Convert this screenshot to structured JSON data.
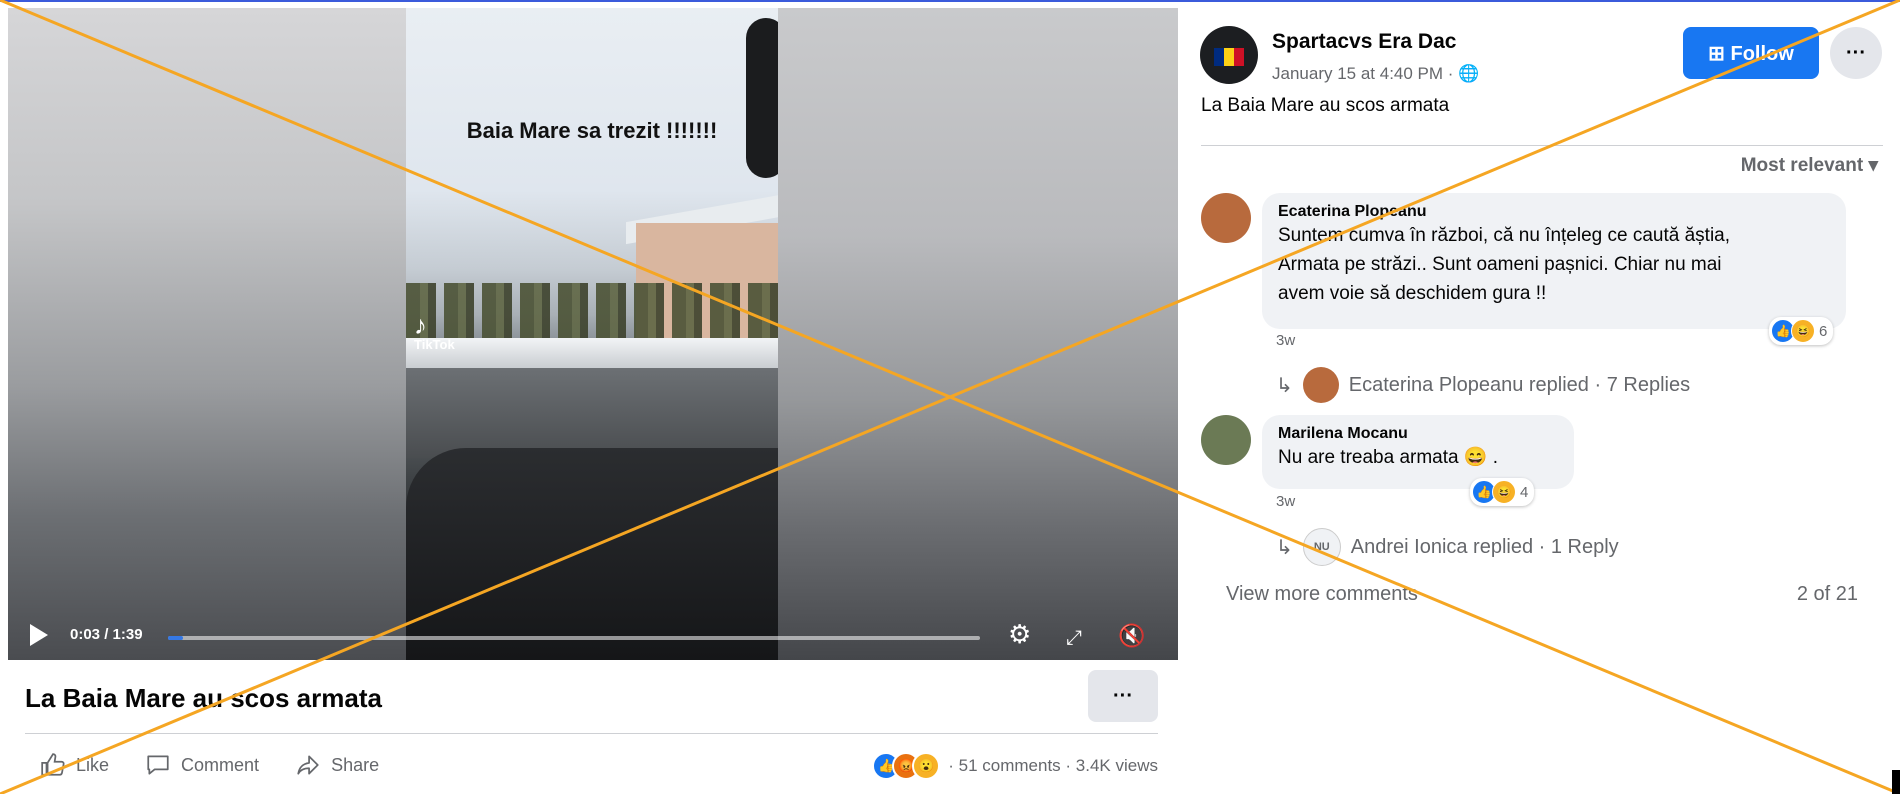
{
  "video": {
    "overlay_caption": "Baia Mare sa trezit !!!!!!!",
    "watermark": "TikTok",
    "time_display": "0:03 / 1:39",
    "progress_fraction": 0.019
  },
  "post": {
    "title": "La Baia Mare au scos armata",
    "more_label": "···",
    "actions": {
      "like": "Like",
      "comment": "Comment",
      "share": "Share"
    },
    "stats": "· 51 comments · 3.4K views"
  },
  "page": {
    "name": "Spartacvs Era Dac",
    "timestamp": "January 15 at 4:40 PM · ",
    "follow_label": "Follow",
    "more_label": "···",
    "post_text": "La Baia Mare au scos armata"
  },
  "comments_sort": "Most relevant",
  "comments": [
    {
      "author": "Ecaterina Plopeanu",
      "lines": [
        "Suntem cumva în război, că nu înțeleg ce caută ăștia,",
        "Armata pe străzi.. Sunt oameni pașnici. Chiar nu mai",
        "avem voie să deschidem gura !!"
      ],
      "age": "3w",
      "reaction_count": "6",
      "replies": "Ecaterina Plopeanu replied · 7 Replies"
    },
    {
      "author": "Marilena Mocanu",
      "lines": [
        "Nu are treaba armata 😄 ."
      ],
      "age": "3w",
      "reaction_count": "4",
      "replies": "Andrei Ionica replied · 1 Reply",
      "reply_avatar_initials": "NU"
    }
  ],
  "view_more": "View more comments",
  "comment_count": "2 of 21",
  "colors": {
    "accent": "#1877f2",
    "cross": "#f5a623",
    "secondary_text": "#65676b"
  }
}
